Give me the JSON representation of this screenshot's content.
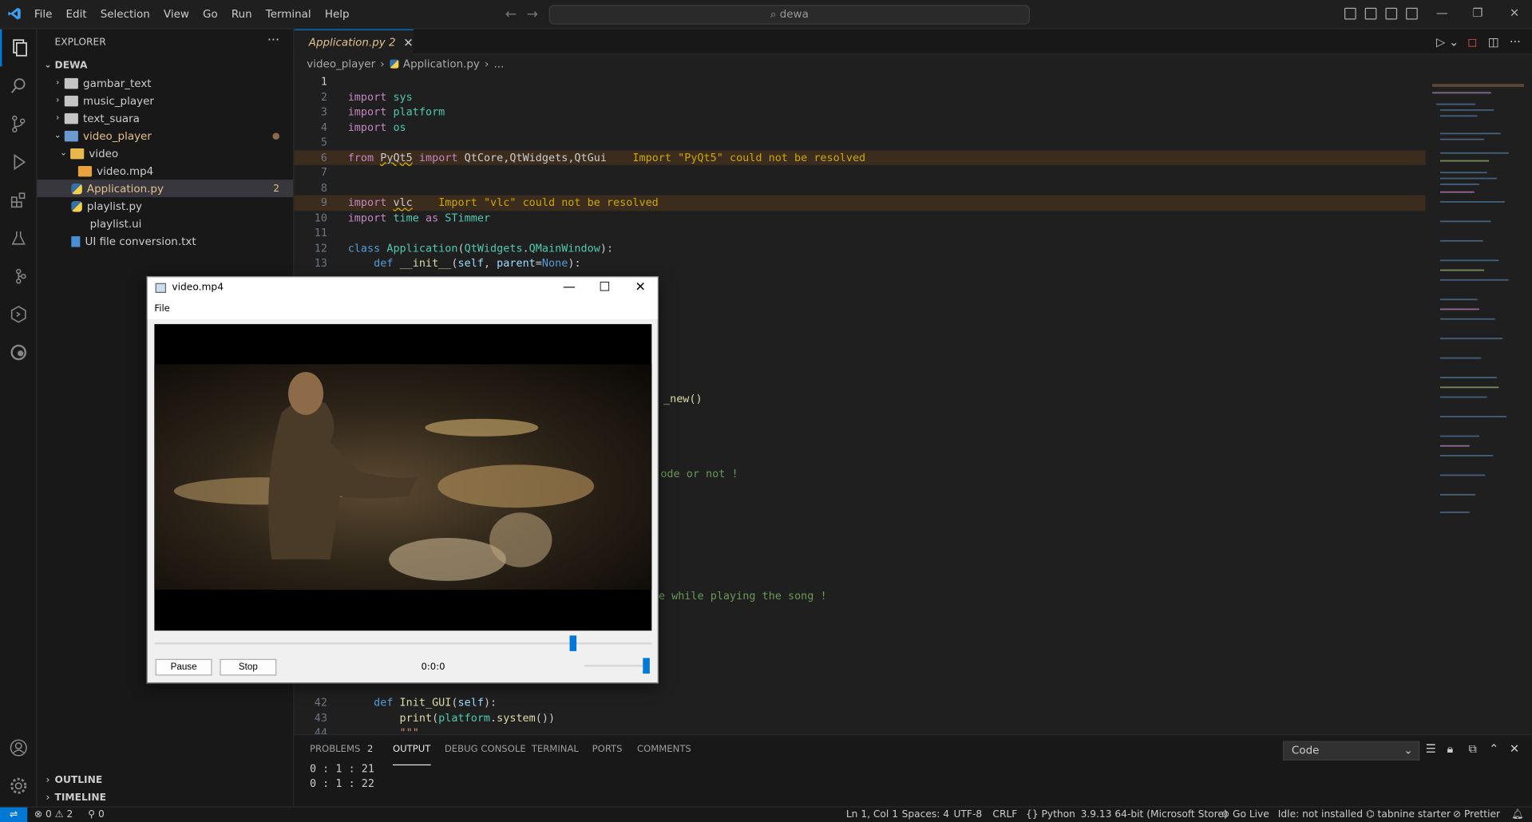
{
  "titlebar": {
    "menu": [
      "File",
      "Edit",
      "Selection",
      "View",
      "Go",
      "Run",
      "Terminal",
      "Help"
    ],
    "search": "dewa"
  },
  "activity": [
    "explorer-icon",
    "search-icon",
    "source-control-icon",
    "run-debug-icon",
    "extensions-icon",
    "testing-icon",
    "git-graph-icon",
    "remote-explorer-icon",
    "edge-devtools-icon",
    "account-icon",
    "settings-gear-icon"
  ],
  "sidebar": {
    "title": "EXPLORER",
    "root": "DEWA",
    "items": [
      {
        "label": "gambar_text",
        "type": "folder",
        "depth": 1,
        "open": false
      },
      {
        "label": "music_player",
        "type": "folder",
        "depth": 1,
        "open": false
      },
      {
        "label": "text_suara",
        "type": "folder",
        "depth": 1,
        "open": false
      },
      {
        "label": "video_player",
        "type": "folder",
        "depth": 1,
        "open": true
      },
      {
        "label": "video",
        "type": "folder",
        "depth": 2,
        "open": true
      },
      {
        "label": "video.mp4",
        "type": "media",
        "depth": 3
      },
      {
        "label": "Application.py",
        "type": "python",
        "depth": 2,
        "badge": "2"
      },
      {
        "label": "playlist.py",
        "type": "python",
        "depth": 2
      },
      {
        "label": "playlist.ui",
        "type": "file",
        "depth": 2
      },
      {
        "label": "UI file conversion.txt",
        "type": "text",
        "depth": 2
      }
    ],
    "outline": "OUTLINE",
    "timeline": "TIMELINE"
  },
  "tab": {
    "label": "Application.py",
    "badge": "2"
  },
  "breadcrumb": {
    "folder": "video_player",
    "file": "Application.py",
    "more": "..."
  },
  "code": {
    "l2": "import",
    "l2b": "sys",
    "l3": "import",
    "l3b": "platform",
    "l4": "import",
    "l4b": "os",
    "l6a": "from",
    "l6b": "PyQt5",
    "l6c": "import",
    "l6d": "QtCore,QtWidgets,QtGui",
    "l6w": "Import \"PyQt5\" could not be resolved",
    "l9a": "import",
    "l9b": "vlc",
    "l9w": "Import \"vlc\" could not be resolved",
    "l10a": "import",
    "l10b": "time",
    "l10c": "as",
    "l10d": "STimmer",
    "l12a": "class",
    "l12b": "Application",
    "l12c": "(",
    "l12d": "QtWidgets",
    "l12e": ".",
    "l12f": "QMainWindow",
    "l12g": "):",
    "l13a": "def",
    "l13b": "__init__",
    "l13c": "(",
    "l13d": "self",
    "l13e": ", ",
    "l13f": "parent",
    "l13g": "=",
    "l13h": "None",
    "l13i": "):",
    "frag1": "_new()",
    "frag2": "ode or not !",
    "frag3": "e while playing the song !",
    "l42a": "def",
    "l42b": "Init_GUI",
    "l42c": "(",
    "l42d": "self",
    "l42e": "):",
    "l43a": "print",
    "l43b": "(",
    "l43c": "platform",
    "l43d": ".",
    "l43e": "system",
    "l43f": "())",
    "l44": "\"\"\""
  },
  "line_numbers": [
    "1",
    "2",
    "3",
    "4",
    "5",
    "6",
    "7",
    "8",
    "9",
    "10",
    "11",
    "12",
    "13",
    "",
    "",
    "",
    "",
    "",
    "",
    "",
    "",
    "",
    "",
    "",
    "",
    "",
    "",
    "",
    "",
    "",
    "",
    "",
    "",
    "",
    "",
    "",
    "",
    "",
    "",
    "",
    "",
    "42",
    "43",
    "44"
  ],
  "panel": {
    "tabs": [
      "PROBLEMS",
      "OUTPUT",
      "DEBUG CONSOLE",
      "TERMINAL",
      "PORTS",
      "COMMENTS"
    ],
    "problems_count": "2",
    "active": "OUTPUT",
    "channel": "Code",
    "output": [
      "0 : 1 : 21",
      "0 : 1 : 22"
    ]
  },
  "status": {
    "errors": "0",
    "warnings": "2",
    "ports": "0",
    "position": "Ln 1, Col 1",
    "spaces": "Spaces: 4",
    "encoding": "UTF-8",
    "eol": "CRLF",
    "language": "Python",
    "interpreter": "3.9.13 64-bit (Microsoft Store)",
    "golive": "Go Live",
    "idle": "Idle: not installed",
    "tabnine": "tabnine starter",
    "prettier": "Prettier"
  },
  "player": {
    "title": "video.mp4",
    "menu": "File",
    "pause": "Pause",
    "stop": "Stop",
    "time": "0:0:0",
    "seek_position": 0.84,
    "volume": 1.0
  }
}
